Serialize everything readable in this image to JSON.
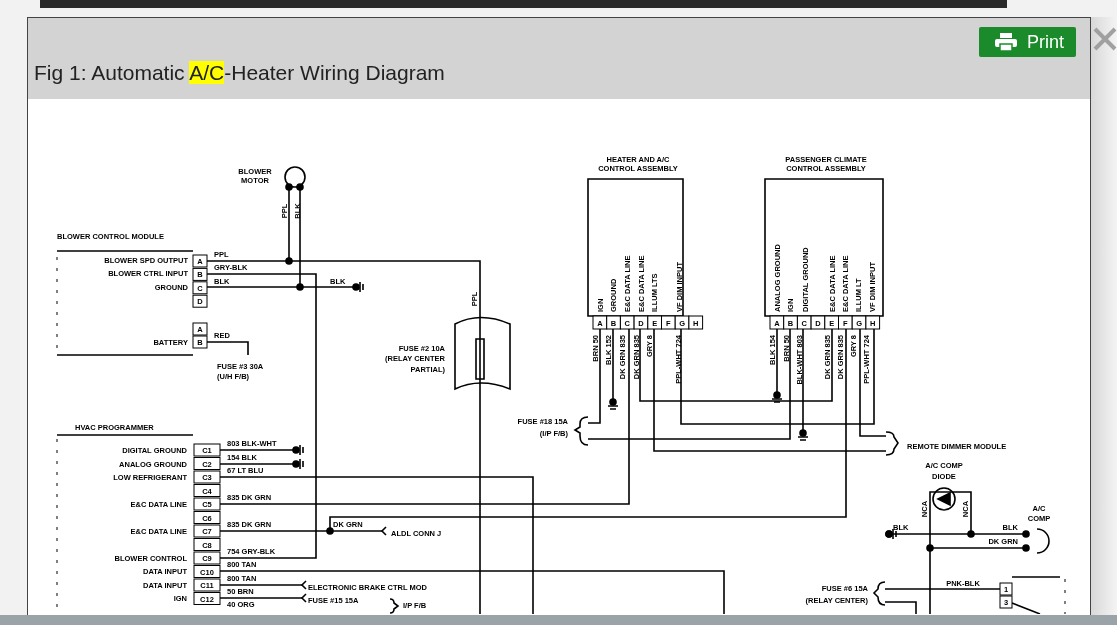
{
  "dialog": {
    "title_parts": [
      {
        "text": "Fig 1: Automatic ",
        "highlighted": false
      },
      {
        "text": "A/C",
        "highlighted": true
      },
      {
        "text": "-Heater Wiring Diagram",
        "highlighted": false
      }
    ],
    "print_button": "Print"
  },
  "diagram": {
    "labels": [
      "BLOWER",
      "MOTOR",
      "PPL",
      "BLK",
      "BLOWER CONTROL MODULE",
      "BLOWER SPD OUTPUT",
      "BLOWER CTRL INPUT",
      "GROUND",
      "PPL",
      "GRY-BLK",
      "BLK",
      "BLK",
      "BATTERY",
      "RED",
      "FUSE #3 30A",
      "(U/H F/B)",
      "PPL",
      "FUSE #2 10A",
      "(RELAY CENTER",
      "PARTIAL)",
      "HEATER AND A/C",
      "CONTROL ASSEMBLY",
      "IGN",
      "GROUND",
      "E&C DATA LINE",
      "E&C DATA LINE",
      "ILLUM LTS",
      "VF DIM INPUT",
      "BRN 50",
      "BLK 152",
      "DK GRN 835",
      "DK GRN 835",
      "GRY 8",
      "PPL-WHT 724",
      "PASSENGER CLIMATE",
      "CONTROL ASSEMBLY",
      "ANALOG GROUND",
      "IGN",
      "DIGITAL GROUND",
      "E&C DATA LINE",
      "E&C DATA LINE",
      "ILLUM LT",
      "VF DIM INPUT",
      "BLK 154",
      "BRN 50",
      "BLK-WHT 803",
      "DK GRN 835",
      "DK GRN 835",
      "GRY 8",
      "PPL-WHT 724",
      "FUSE #18 15A",
      "(I/P F/B)",
      "REMOTE DIMMER MODULE",
      "A/C COMP",
      "DIODE",
      "NCA",
      "NCA",
      "BLK",
      "BLK",
      "DK GRN",
      "A/C",
      "COMP",
      "PNK-BLK",
      "FUSE #6 15A",
      "(RELAY CENTER)",
      "HVAC PROGRAMMER",
      "DIGITAL GROUND",
      "ANALOG GROUND",
      "LOW REFRIGERANT",
      "E&C DATA LINE",
      "E&C DATA LINE",
      "BLOWER CONTROL",
      "DATA INPUT",
      "DATA INPUT",
      "IGN",
      "803 BLK-WHT",
      "154 BLK",
      "67 LT BLU",
      "835 DK GRN",
      "835 DK GRN",
      "754 GRY-BLK",
      "800 TAN",
      "800 TAN",
      "50 BRN",
      "40 ORG",
      "DK GRN",
      "ALDL CONN J",
      "ELECTRONIC BRAKE CTRL MOD",
      "FUSE #15 15A",
      "I/P F/B"
    ],
    "connectors": [
      {
        "pins": [
          "A",
          "B",
          "C",
          "D"
        ]
      },
      {
        "pins": [
          "A",
          "B"
        ]
      },
      {
        "pins": [
          "C1",
          "C2",
          "C3",
          "C4",
          "C5",
          "C6",
          "C7",
          "C8",
          "C9",
          "C10",
          "C11",
          "C12"
        ]
      },
      {
        "pins": [
          "A",
          "B",
          "C",
          "D",
          "E",
          "F",
          "G",
          "H"
        ]
      },
      {
        "pins": [
          "A",
          "B",
          "C",
          "D",
          "E",
          "F",
          "G",
          "H"
        ]
      },
      {
        "pins": [
          "1",
          "3"
        ]
      }
    ]
  }
}
